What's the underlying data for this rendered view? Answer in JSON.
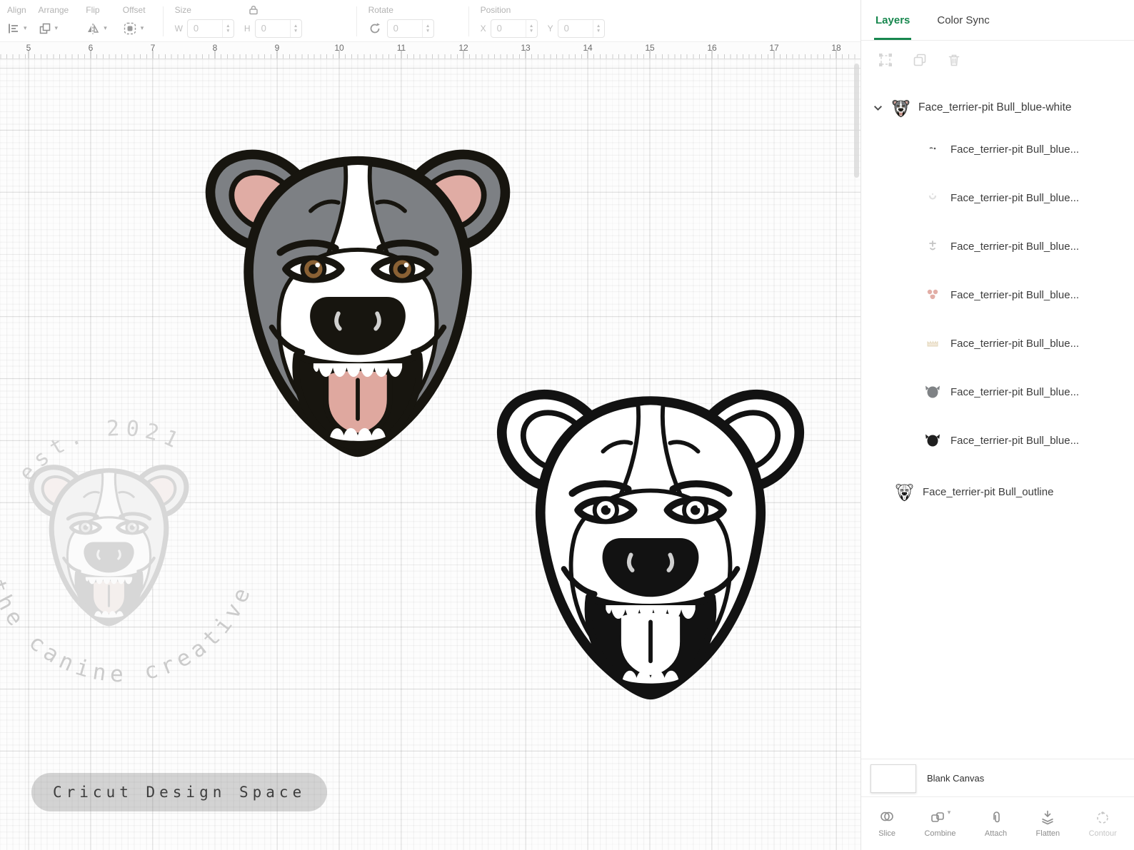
{
  "toolbar": {
    "groups": {
      "align": "Align",
      "arrange": "Arrange",
      "flip": "Flip",
      "offset": "Offset",
      "size": "Size",
      "rotate": "Rotate",
      "position": "Position"
    },
    "size": {
      "w_label": "W",
      "h_label": "H",
      "w_value": "0",
      "h_value": "0"
    },
    "rotate_value": "0",
    "position": {
      "x_label": "X",
      "y_label": "Y",
      "x_value": "0",
      "y_value": "0"
    }
  },
  "ruler": {
    "numbers": [
      "5",
      "6",
      "7",
      "8",
      "9",
      "10",
      "11",
      "12",
      "13",
      "14",
      "15",
      "16",
      "17",
      "18"
    ]
  },
  "canvas": {
    "watermark_top": "est. 2021",
    "watermark_bottom": "the canine creative",
    "badge": "Cricut Design Space"
  },
  "panel": {
    "tabs": {
      "layers": "Layers",
      "color_sync": "Color Sync"
    },
    "layers": {
      "group_label": "Face_terrier-pit Bull_blue-white",
      "children": [
        {
          "label": "Face_terrier-pit Bull_blue...",
          "thumb": "eye-details"
        },
        {
          "label": "Face_terrier-pit Bull_blue...",
          "thumb": "light-shading"
        },
        {
          "label": "Face_terrier-pit Bull_blue...",
          "thumb": "face-marks"
        },
        {
          "label": "Face_terrier-pit Bull_blue...",
          "thumb": "pink-parts"
        },
        {
          "label": "Face_terrier-pit Bull_blue...",
          "thumb": "teeth"
        },
        {
          "label": "Face_terrier-pit Bull_blue...",
          "thumb": "gray-head"
        },
        {
          "label": "Face_terrier-pit Bull_blue...",
          "thumb": "black-head"
        }
      ],
      "outline_label": "Face_terrier-pit Bull_outline"
    },
    "blank_canvas_label": "Blank Canvas",
    "actions": [
      {
        "label": "Slice"
      },
      {
        "label": "Combine"
      },
      {
        "label": "Attach"
      },
      {
        "label": "Flatten"
      },
      {
        "label": "Contour"
      }
    ]
  },
  "colors": {
    "accent_green": "#17874e",
    "dog_gray": "#7d8084",
    "dog_pink": "#e0aca4"
  }
}
